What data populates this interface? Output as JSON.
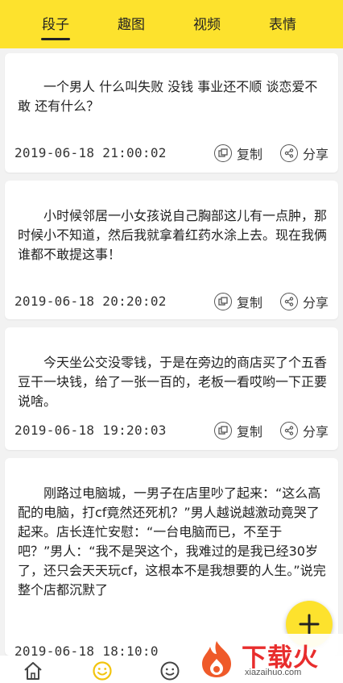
{
  "tabs": [
    {
      "label": "段子",
      "active": true
    },
    {
      "label": "趣图",
      "active": false
    },
    {
      "label": "视频",
      "active": false
    },
    {
      "label": "表情",
      "active": false
    }
  ],
  "actions": {
    "copy_label": "复制",
    "share_label": "分享"
  },
  "posts": [
    {
      "text": "一个男人 什么叫失败 没钱 事业还不顺 谈恋爱不敢 还有什么？",
      "timestamp": "2019-06-18 21:00:02"
    },
    {
      "text": "小时候邻居一小女孩说自己胸部这儿有一点肿，那时候小不知道，然后我就拿着红药水涂上去。现在我俩谁都不敢提这事！",
      "timestamp": "2019-06-18 20:20:02"
    },
    {
      "text": "今天坐公交没零钱，于是在旁边的商店买了个五香豆干一块钱，给了一张一百的，老板一看哎哟一下正要说啥。",
      "timestamp": "2019-06-18 19:20:03"
    },
    {
      "text": "刚路过电脑城，一男子在店里吵了起来：“这么高配的电脑，打cf竟然还死机？”男人越说越激动竟哭了起来。店长连忙安慰：“一台电脑而已，不至于吧？”男人：“我不是哭这个，我难过的是我已经30岁了，还只会天天玩cf，这根本不是我想要的人生。”说完整个店都沉默了",
      "timestamp": "2019-06-18 18:10:0"
    }
  ],
  "colors": {
    "accent": "#fde22d",
    "watermark_red": "#e82d2d"
  },
  "watermark": {
    "text": "下载火",
    "sub": "xiazaihuo.com"
  }
}
